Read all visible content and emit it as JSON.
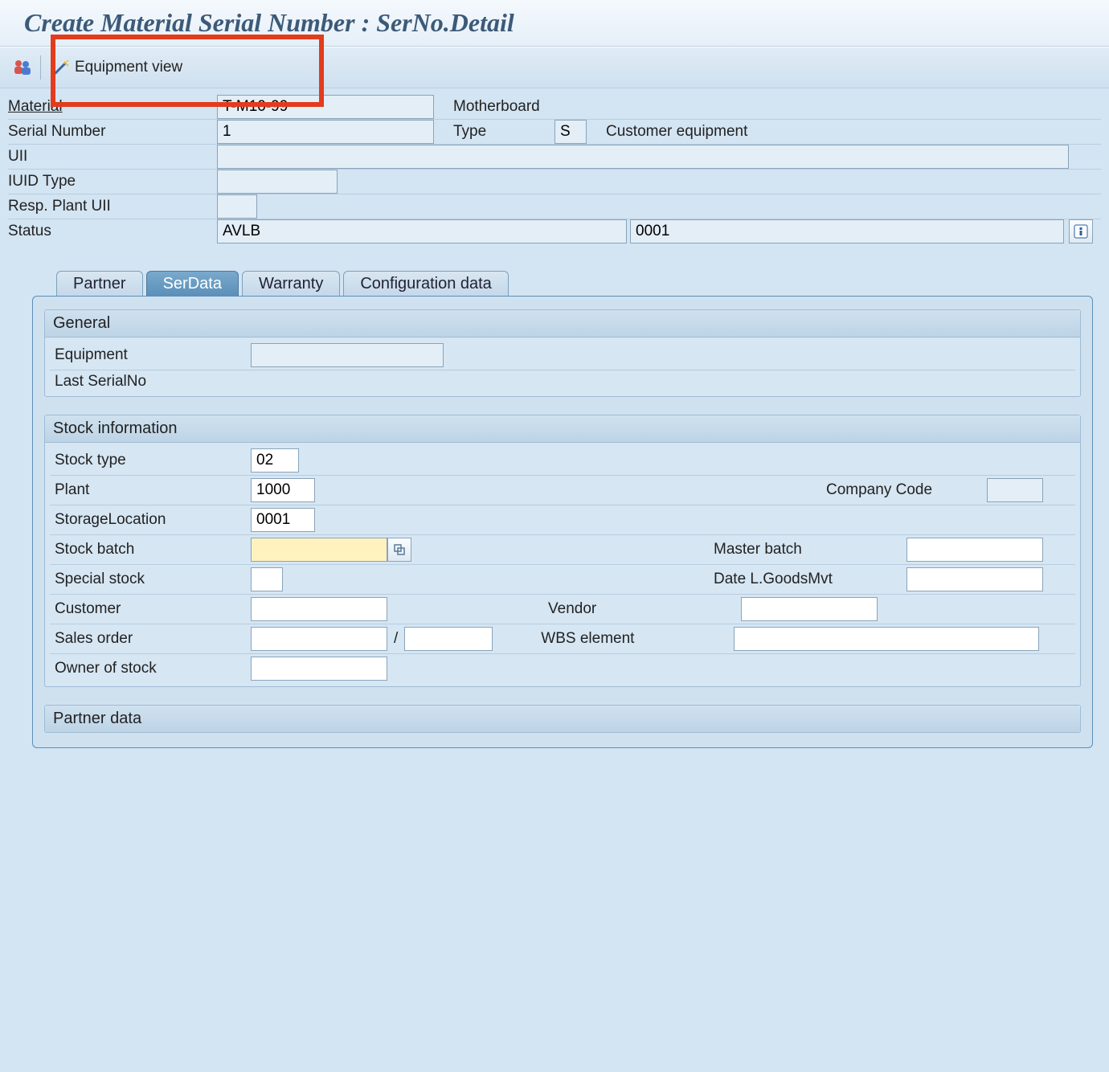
{
  "page_title": "Create Material Serial Number : SerNo.Detail",
  "toolbar": {
    "equipment_view_label": "Equipment view"
  },
  "header": {
    "material_label": "Material",
    "material_value": "T-M10-99",
    "material_desc": "Motherboard",
    "serial_label": "Serial Number",
    "serial_value": "1",
    "type_label": "Type",
    "type_value": "S",
    "type_desc": "Customer equipment",
    "uii_label": "UII",
    "uii_value": "",
    "iuid_type_label": "IUID Type",
    "iuid_type_value": "",
    "resp_plant_uii_label": "Resp. Plant UII",
    "resp_plant_uii_value": "",
    "status_label": "Status",
    "status_value": "AVLB",
    "status_code": "0001"
  },
  "tabs": {
    "partner": "Partner",
    "serdata": "SerData",
    "warranty": "Warranty",
    "config": "Configuration data"
  },
  "general": {
    "title": "General",
    "equipment_label": "Equipment",
    "equipment_value": "",
    "last_serial_label": "Last SerialNo"
  },
  "stock": {
    "title": "Stock information",
    "stock_type_label": "Stock type",
    "stock_type_value": "02",
    "plant_label": "Plant",
    "plant_value": "1000",
    "company_code_label": "Company Code",
    "company_code_value": "",
    "storage_loc_label": "StorageLocation",
    "storage_loc_value": "0001",
    "stock_batch_label": "Stock batch",
    "stock_batch_value": "",
    "master_batch_label": "Master batch",
    "master_batch_value": "",
    "special_stock_label": "Special stock",
    "special_stock_value": "",
    "date_goodsmvt_label": "Date L.GoodsMvt",
    "date_goodsmvt_value": "",
    "customer_label": "Customer",
    "customer_value": "",
    "vendor_label": "Vendor",
    "vendor_value": "",
    "sales_order_label": "Sales order",
    "sales_order_value": "",
    "sales_order_item_value": "",
    "sales_order_sep": "/",
    "wbs_label": "WBS element",
    "wbs_value": "",
    "owner_label": "Owner of stock",
    "owner_value": ""
  },
  "partner_data_title": "Partner data"
}
